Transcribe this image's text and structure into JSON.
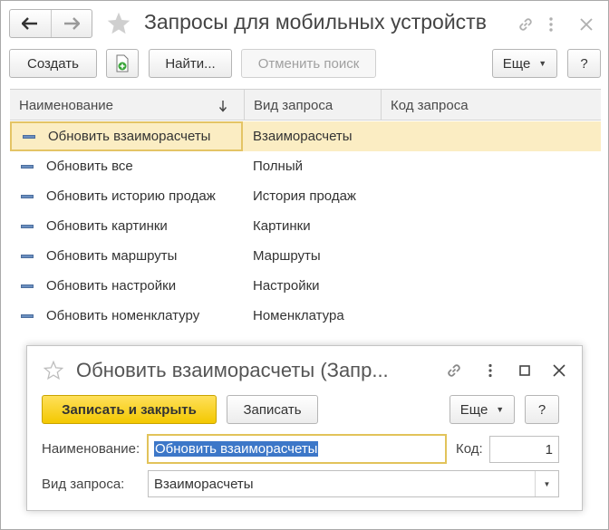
{
  "window": {
    "title": "Запросы для мобильных устройств"
  },
  "toolbar": {
    "create_label": "Создать",
    "find_label": "Найти...",
    "cancel_search_label": "Отменить поиск",
    "more_label": "Еще",
    "help_label": "?"
  },
  "table": {
    "columns": {
      "name": "Наименование",
      "type": "Вид запроса",
      "code": "Код запроса"
    },
    "rows": [
      {
        "name": "Обновить взаиморасчеты",
        "type": "Взаиморасчеты"
      },
      {
        "name": "Обновить все",
        "type": "Полный"
      },
      {
        "name": "Обновить историю продаж",
        "type": "История продаж"
      },
      {
        "name": "Обновить картинки",
        "type": "Картинки"
      },
      {
        "name": "Обновить маршруты",
        "type": "Маршруты"
      },
      {
        "name": "Обновить настройки",
        "type": "Настройки"
      },
      {
        "name": "Обновить номенклатуру",
        "type": "Номенклатура"
      }
    ]
  },
  "dialog": {
    "title": "Обновить взаиморасчеты (Запр...",
    "save_close_label": "Записать и закрыть",
    "save_label": "Записать",
    "more_label": "Еще",
    "help_label": "?",
    "name_label": "Наименование:",
    "name_value": "Обновить взаиморасчеты",
    "code_label": "Код:",
    "code_value": "1",
    "type_label": "Вид запроса:",
    "type_value": "Взаиморасчеты"
  },
  "colors": {
    "selected_row": "#fbedc3",
    "primary_button": "#f3c800",
    "text_selection": "#3c77c8"
  },
  "icons": {
    "back": "arrow-left-icon",
    "forward": "arrow-right-icon",
    "favorite": "star-icon",
    "link": "link-icon",
    "menu": "kebab-icon",
    "close": "close-icon",
    "maximize": "maximize-icon",
    "copy": "copy-document-icon",
    "sort": "sort-down-icon",
    "dropdown": "chevron-down-icon"
  }
}
